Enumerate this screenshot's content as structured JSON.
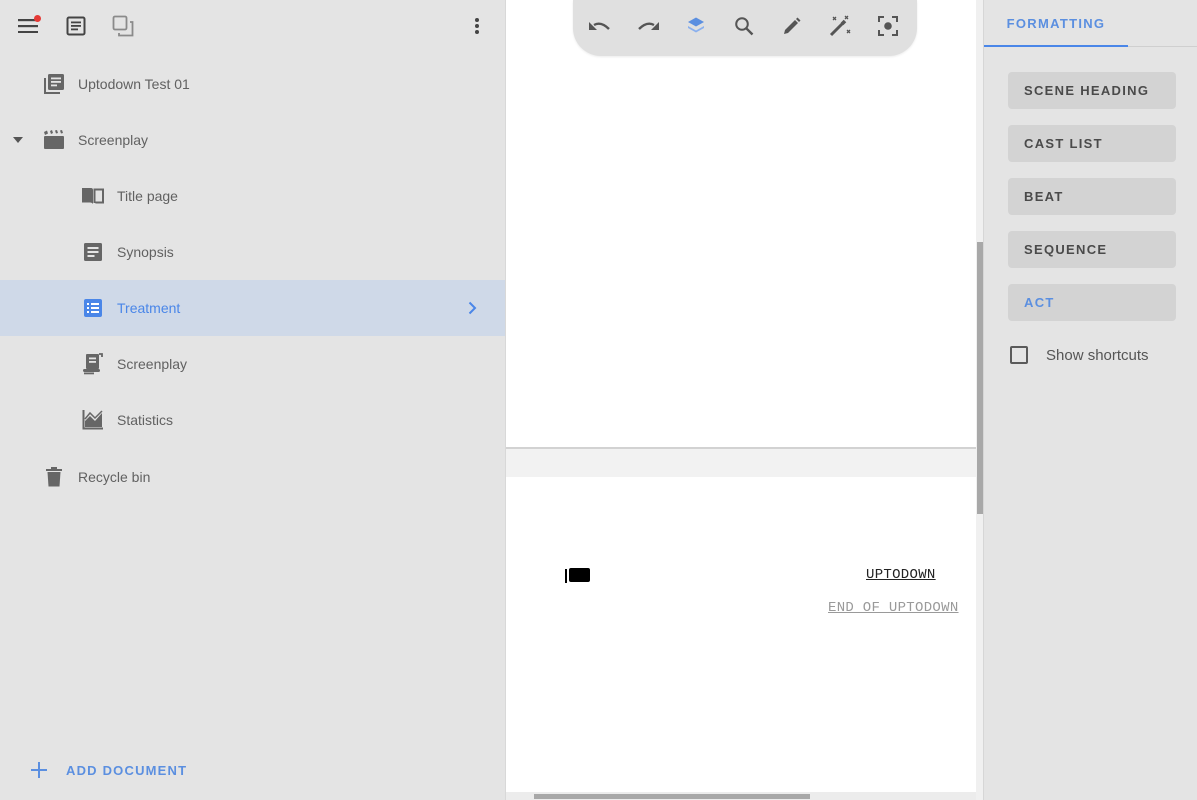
{
  "topbar": {
    "icons": [
      "menu-icon",
      "document-icon",
      "copy-icon",
      "more-vert-icon"
    ],
    "has_notification": true
  },
  "tree": {
    "project": {
      "label": "Uptodown Test 01",
      "icon": "library-books-icon"
    },
    "screenplay_folder": {
      "label": "Screenplay",
      "icon": "clapperboard-icon",
      "expanded": true
    },
    "children": [
      {
        "label": "Title page",
        "icon": "book-open-icon"
      },
      {
        "label": "Synopsis",
        "icon": "notes-icon"
      },
      {
        "label": "Treatment",
        "icon": "list-icon",
        "selected": true
      },
      {
        "label": "Screenplay",
        "icon": "script-icon"
      },
      {
        "label": "Statistics",
        "icon": "chart-icon"
      }
    ],
    "recycle_bin": {
      "label": "Recycle bin",
      "icon": "trash-icon"
    }
  },
  "add_document": {
    "label": "ADD DOCUMENT"
  },
  "toolbar": {
    "tools": [
      "undo",
      "redo",
      "layers",
      "search",
      "pen",
      "magic-wand",
      "focus"
    ],
    "active_tool": "layers"
  },
  "editor": {
    "title_text": "UPTODOWN",
    "end_text": "END OF UPTODOWN"
  },
  "right_panel": {
    "tab": "FORMATTING",
    "buttons": [
      {
        "label": "SCENE HEADING"
      },
      {
        "label": "CAST LIST"
      },
      {
        "label": "BEAT"
      },
      {
        "label": "SEQUENCE"
      },
      {
        "label": "ACT",
        "active": true
      }
    ],
    "show_shortcuts": {
      "label": "Show shortcuts",
      "checked": false
    }
  },
  "colors": {
    "accent": "#4a86e8",
    "selected_bg": "#cfd9e8",
    "notification": "#e53935",
    "sidebar_bg": "#e4e4e4"
  }
}
